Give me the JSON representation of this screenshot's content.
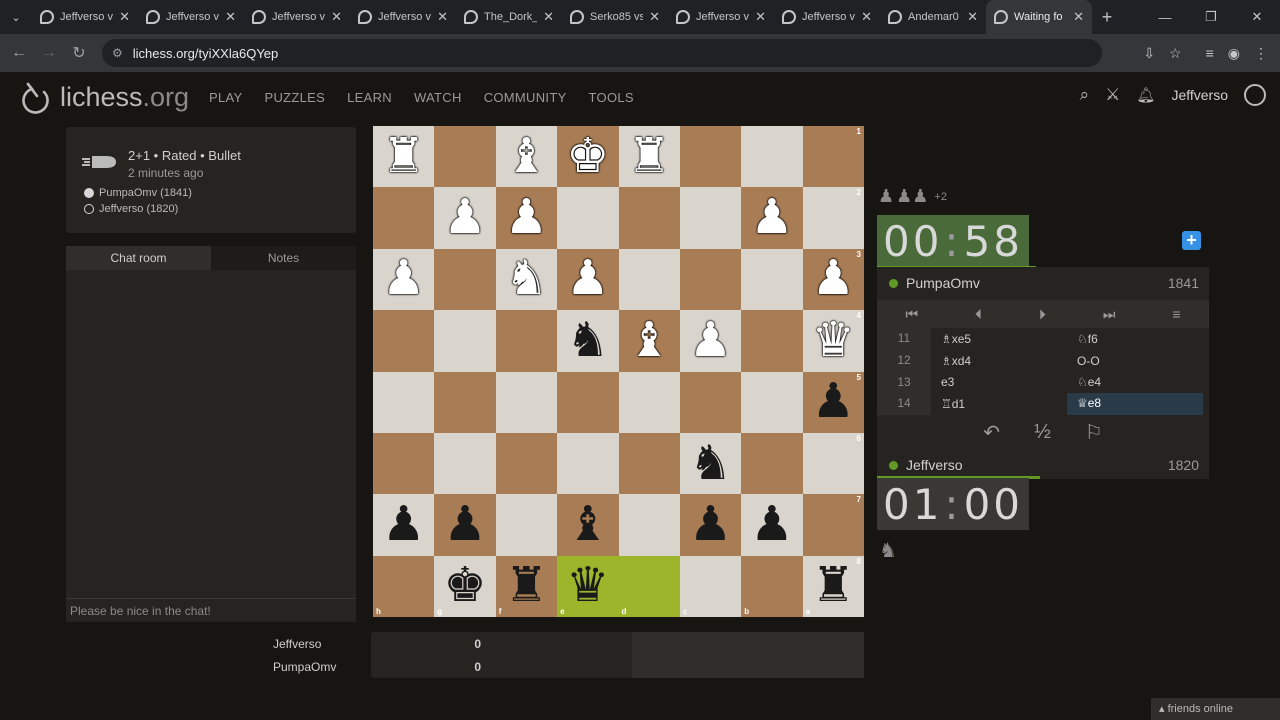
{
  "browser": {
    "tabs": [
      {
        "label": "Jeffverso v",
        "active": false
      },
      {
        "label": "Jeffverso v",
        "active": false
      },
      {
        "label": "Jeffverso v",
        "active": false
      },
      {
        "label": "Jeffverso v",
        "active": false
      },
      {
        "label": "The_Dork_",
        "active": false
      },
      {
        "label": "Serko85 vs",
        "active": false
      },
      {
        "label": "Jeffverso v",
        "active": false
      },
      {
        "label": "Jeffverso v",
        "active": false
      },
      {
        "label": "Andemar0",
        "active": false
      },
      {
        "label": "Waiting fo",
        "active": true
      }
    ],
    "url": "lichess.org/tyiXXla6QYep"
  },
  "site": {
    "logo_main": "lichess",
    "logo_tld": ".org",
    "nav": [
      "PLAY",
      "PUZZLES",
      "LEARN",
      "WATCH",
      "COMMUNITY",
      "TOOLS"
    ],
    "username": "Jeffverso"
  },
  "game": {
    "title": "2+1 • Rated • Bullet",
    "time_ago": "2 minutes ago",
    "white_player": "PumpaOmv (1841)",
    "black_player": "Jeffverso (1820)"
  },
  "chat": {
    "tab_chat": "Chat room",
    "tab_notes": "Notes",
    "placeholder": "Please be nice in the chat!"
  },
  "board": {
    "ranks_label": [
      "1",
      "2",
      "3",
      "4",
      "5",
      "6",
      "7",
      "8"
    ],
    "files_label": [
      "h",
      "g",
      "f",
      "e",
      "d",
      "c",
      "b",
      "a"
    ],
    "position": [
      [
        "wR",
        "",
        "wB",
        "wK",
        "wR",
        "",
        "",
        ""
      ],
      [
        "",
        "wP",
        "wP",
        "",
        "",
        "",
        "wP",
        ""
      ],
      [
        "wP",
        "",
        "wN",
        "wP",
        "",
        "",
        "",
        "wP"
      ],
      [
        "",
        "",
        "",
        "bN",
        "wB",
        "wP",
        "",
        "wQ"
      ],
      [
        "",
        "",
        "",
        "",
        "",
        "",
        "",
        "bP"
      ],
      [
        "",
        "",
        "",
        "",
        "",
        "bN",
        "",
        ""
      ],
      [
        "bP",
        "bP",
        "",
        "bB",
        "",
        "bP",
        "bP",
        ""
      ],
      [
        "",
        "bK",
        "bR",
        "bQ",
        "",
        "",
        "",
        "bR"
      ]
    ],
    "highlight": [
      [
        7,
        3
      ],
      [
        7,
        4
      ]
    ]
  },
  "opponent": {
    "name": "PumpaOmv",
    "rating": "1841",
    "clock_min": "00",
    "clock_sec": "58",
    "material_plus": "+2",
    "time_fraction": 0.48
  },
  "me": {
    "name": "Jeffverso",
    "rating": "1820",
    "clock_min": "01",
    "clock_sec": "00",
    "time_fraction": 0.49
  },
  "moves": [
    {
      "num": "11",
      "white": "♗xe5",
      "black": "♘f6"
    },
    {
      "num": "12",
      "white": "♗xd4",
      "black": "O-O"
    },
    {
      "num": "13",
      "white": "e3",
      "black": "♘e4"
    },
    {
      "num": "14",
      "white": "♖d1",
      "black": "♕e8"
    }
  ],
  "score": {
    "rows": [
      {
        "name": "Jeffverso",
        "score": "0"
      },
      {
        "name": "PumpaOmv",
        "score": "0"
      }
    ]
  },
  "friends": "friends online",
  "colors": {
    "clock_active": "#4a6a3a",
    "online_dot": "#629924",
    "light_square": "#d9d4cc",
    "dark_square": "#a87c54",
    "highlight": "#9cb52a"
  }
}
